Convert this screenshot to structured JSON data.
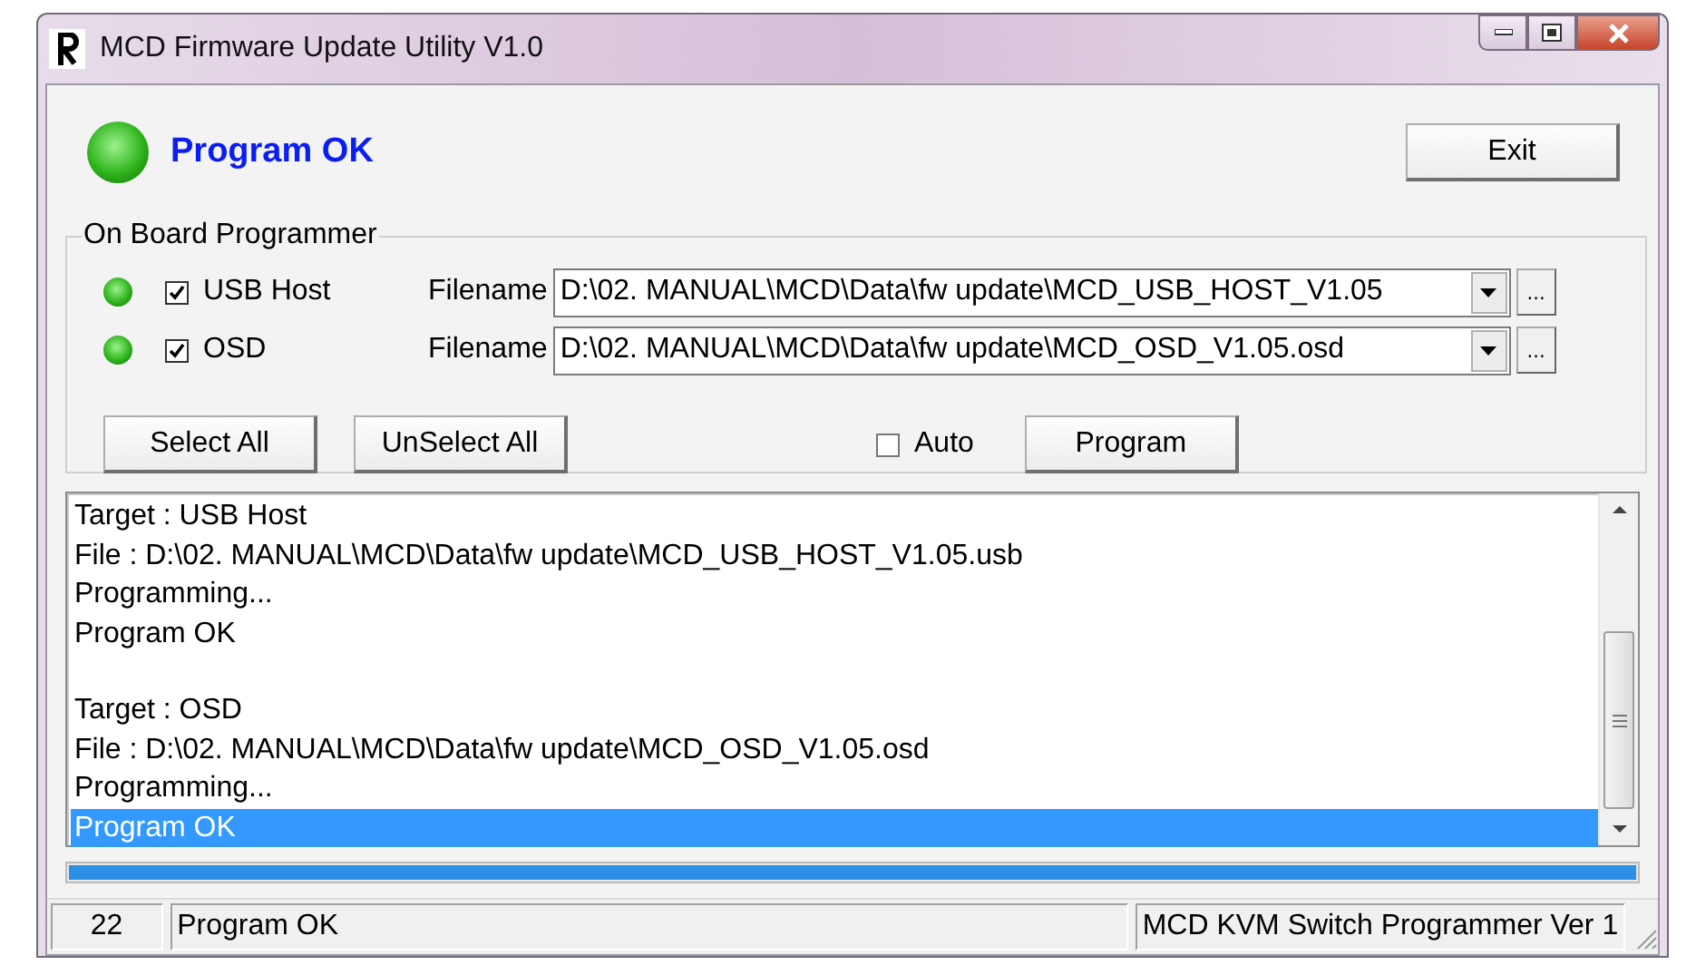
{
  "window": {
    "title": "MCD Firmware Update Utility V1.0"
  },
  "status": {
    "text": "Program OK",
    "on": true
  },
  "exit_button": "Exit",
  "programmer": {
    "title": "On Board Programmer",
    "devices": [
      {
        "led_on": true,
        "checked": true,
        "name": "USB Host",
        "filename_label": "Filename",
        "filename": "D:\\02. MANUAL\\MCD\\Data\\fw update\\MCD_USB_HOST_V1.05",
        "browse": "..."
      },
      {
        "led_on": true,
        "checked": true,
        "name": "OSD",
        "filename_label": "Filename",
        "filename": "D:\\02. MANUAL\\MCD\\Data\\fw update\\MCD_OSD_V1.05.osd",
        "browse": "..."
      }
    ],
    "select_all": "Select All",
    "unselect_all": "UnSelect All",
    "auto": {
      "label": "Auto",
      "checked": false
    },
    "program_button": "Program"
  },
  "log": {
    "blocks": [
      {
        "lines": [
          {
            "text": "Target : USB Host",
            "selected": false
          },
          {
            "text": "File : D:\\02. MANUAL\\MCD\\Data\\fw update\\MCD_USB_HOST_V1.05.usb",
            "selected": false
          },
          {
            "text": "Programming...",
            "selected": false
          },
          {
            "text": "Program OK",
            "selected": false
          }
        ]
      },
      {
        "lines": [
          {
            "text": "Target : OSD",
            "selected": false
          },
          {
            "text": "File : D:\\02. MANUAL\\MCD\\Data\\fw update\\MCD_OSD_V1.05.osd",
            "selected": false
          },
          {
            "text": "Programming...",
            "selected": false
          },
          {
            "text": "Program OK",
            "selected": true
          }
        ]
      }
    ]
  },
  "progress": {
    "level": 1
  },
  "status_bar": {
    "count": "22",
    "message": "Program OK",
    "version": "MCD KVM Switch Programmer Ver 1"
  }
}
